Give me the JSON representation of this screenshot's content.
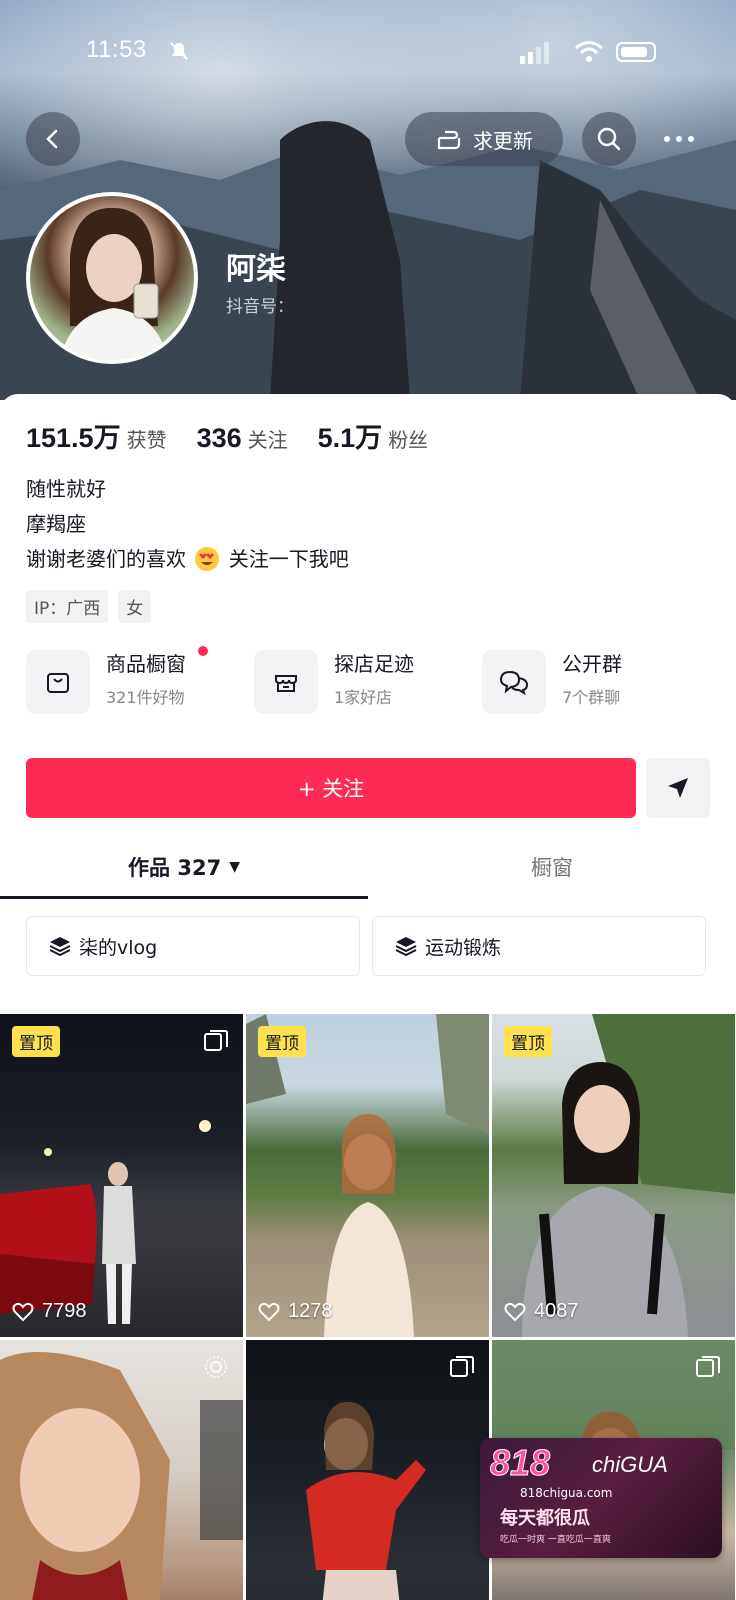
{
  "status_bar": {
    "time": "11:53"
  },
  "header": {
    "request_update_label": "求更新"
  },
  "profile": {
    "nickname": "阿柒",
    "douyin_id_label": "抖音号："
  },
  "stats": [
    {
      "value": "151.5万",
      "label": "获赞"
    },
    {
      "value": "336",
      "label": "关注"
    },
    {
      "value": "5.1万",
      "label": "粉丝"
    }
  ],
  "bio": {
    "line1": "随性就好",
    "line2": "摩羯座",
    "line3_prefix": "谢谢老婆们的喜欢",
    "line3_suffix": "关注一下我吧"
  },
  "tags": {
    "ip": "IP：广西",
    "gender": "女"
  },
  "services": [
    {
      "title": "商品橱窗",
      "subtitle": "321件好物"
    },
    {
      "title": "探店足迹",
      "subtitle": "1家好店"
    },
    {
      "title": "公开群",
      "subtitle": "7个群聊"
    }
  ],
  "actions": {
    "follow_label": "+ 关注"
  },
  "tabs": {
    "works_label": "作品 327",
    "showcase_label": "橱窗"
  },
  "collections": [
    {
      "label": "柒的vlog"
    },
    {
      "label": "运动锻炼"
    }
  ],
  "videos": [
    {
      "pinned_label": "置顶",
      "likes": "7798"
    },
    {
      "pinned_label": "置顶",
      "likes": "1278"
    },
    {
      "pinned_label": "置顶",
      "likes": "4087"
    }
  ],
  "watermark": {
    "logo": "818",
    "logo_sub": "chiGUA",
    "url": "818chigua.com",
    "slogan": "每天都很瓜",
    "small_text": "吃瓜一时爽 一直吃瓜一直爽"
  },
  "colors": {
    "accent": "#fe2c55",
    "pin": "#ffe14d"
  }
}
